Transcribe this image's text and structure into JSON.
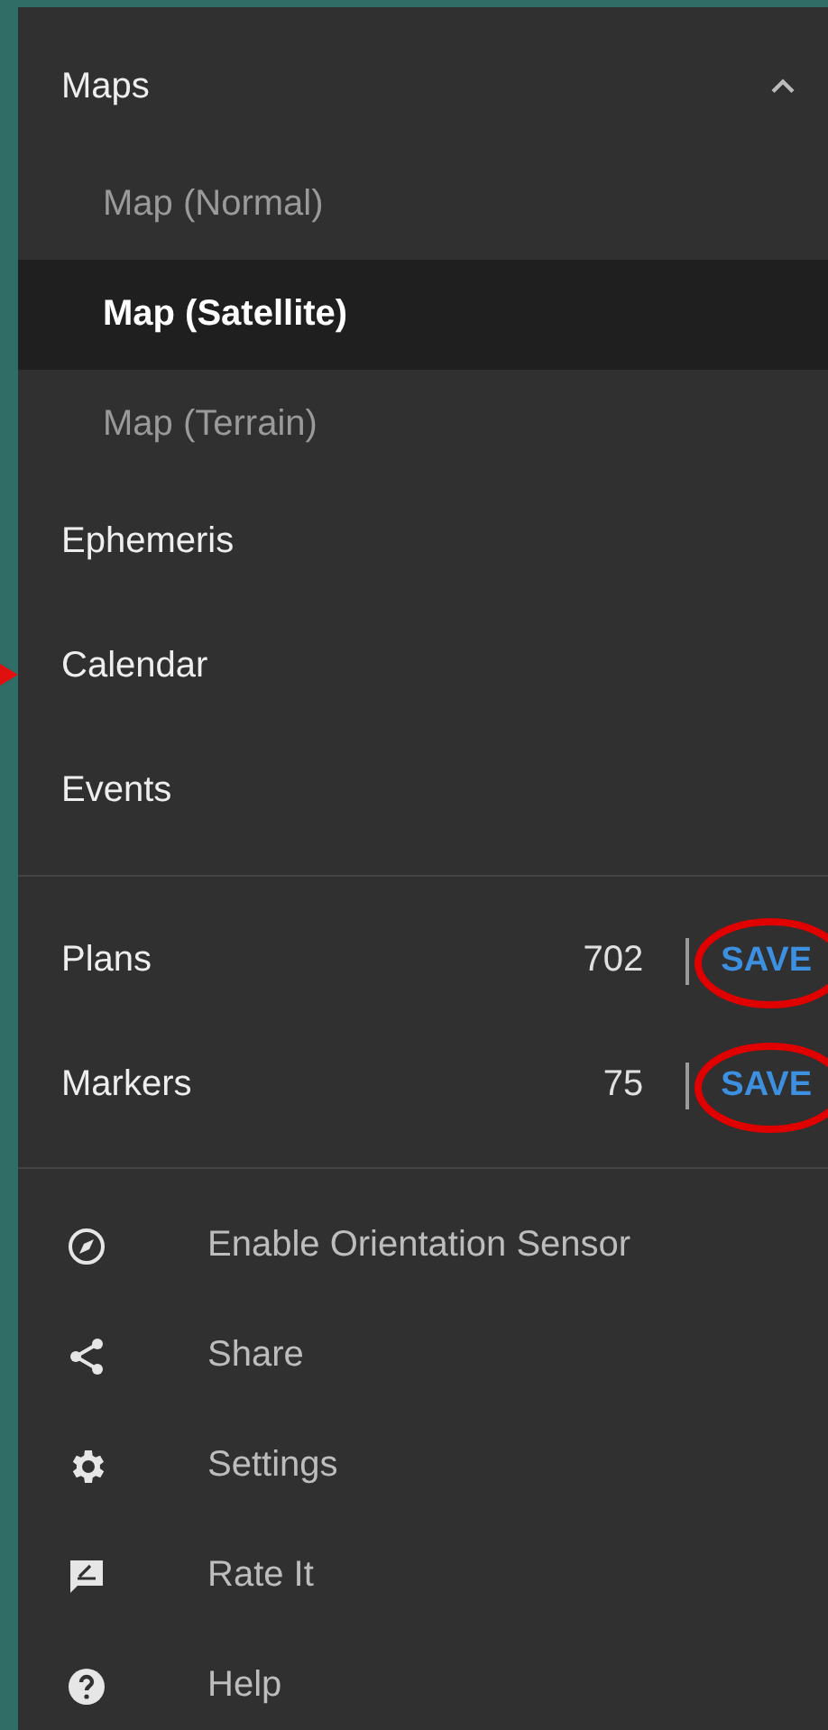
{
  "maps": {
    "label": "Maps",
    "expanded": true,
    "children": [
      {
        "label": "Map (Normal)",
        "selected": false
      },
      {
        "label": "Map (Satellite)",
        "selected": true
      },
      {
        "label": "Map (Terrain)",
        "selected": false
      }
    ]
  },
  "items": [
    {
      "label": "Ephemeris"
    },
    {
      "label": "Calendar",
      "pointed": true
    },
    {
      "label": "Events"
    }
  ],
  "counters": [
    {
      "label": "Plans",
      "count": "702",
      "action": "SAVE",
      "circled": true
    },
    {
      "label": "Markers",
      "count": "75",
      "action": "SAVE",
      "circled": true
    }
  ],
  "actions": [
    {
      "kind": "compass",
      "label": "Enable Orientation Sensor"
    },
    {
      "kind": "share",
      "label": "Share"
    },
    {
      "kind": "settings",
      "label": "Settings"
    },
    {
      "kind": "feedback",
      "label": "Rate It"
    },
    {
      "kind": "help",
      "label": "Help"
    }
  ]
}
